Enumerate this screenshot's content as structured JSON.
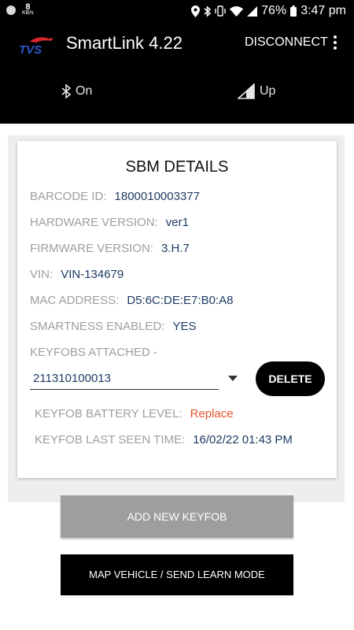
{
  "status_bar": {
    "speed_value": "8",
    "speed_unit": "KB/s",
    "battery": "76%",
    "time": "3:47 pm",
    "icons": [
      "notification-dot-icon",
      "location-icon",
      "bluetooth-icon",
      "vibrate-icon",
      "wifi-icon",
      "signal-icon",
      "battery-icon"
    ]
  },
  "app_bar": {
    "logo_text": "TVS",
    "title": "SmartLink 4.22",
    "disconnect_label": "DISCONNECT",
    "overflow_icon": "more-vert-icon"
  },
  "connection": {
    "bluetooth_label": "On",
    "signal_label": "Up"
  },
  "sbm": {
    "title": "SBM DETAILS",
    "barcode_label": "BARCODE ID:",
    "barcode_value": "1800010003377",
    "hardware_label": "HARDWARE VERSION:",
    "hardware_value": "ver1",
    "firmware_label": "FIRMWARE VERSION:",
    "firmware_value": "3.H.7",
    "vin_label": "VIN:",
    "vin_value": "VIN-134679",
    "mac_label": "MAC ADDRESS:",
    "mac_value": "D5:6C:DE:E7:B0:A8",
    "smartness_label": "SMARTNESS ENABLED:",
    "smartness_value": "YES",
    "keyfobs_label": "KEYFOBS ATTACHED -",
    "keyfob_selected": "211310100013",
    "delete_label": "DELETE",
    "battery_label": "KEYFOB BATTERY LEVEL:",
    "battery_value": "Replace",
    "last_seen_label": "KEYFOB LAST SEEN TIME:",
    "last_seen_value": "16/02/22 01:43 PM"
  },
  "actions": {
    "add_keyfob_label": "ADD NEW KEYFOB",
    "map_vehicle_label": "MAP VEHICLE / SEND LEARN MODE"
  },
  "colors": {
    "header_bg": "#000000",
    "value_text": "#1e3b63",
    "label_text": "#9e9e9e",
    "warning_text": "#e5532b",
    "logo_blue": "#1d3d8f",
    "logo_red": "#d7262b"
  }
}
